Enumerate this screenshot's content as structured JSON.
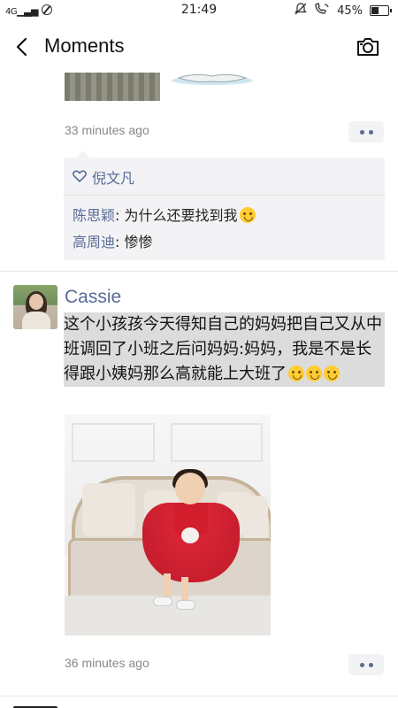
{
  "status_bar": {
    "network": "4G",
    "time": "21:49",
    "battery_percent": "45%"
  },
  "nav": {
    "title": "Moments"
  },
  "previous_post": {
    "timestamp": "33 minutes ago",
    "likes": {
      "names": "倪文凡"
    },
    "comments": [
      {
        "author": "陈思颖",
        "separator": ": ",
        "text": "为什么还要找到我"
      },
      {
        "author": "高周迪",
        "separator": ": ",
        "text": "惨惨"
      }
    ]
  },
  "post": {
    "author": "Cassie",
    "text": "这个小孩孩今天得知自己的妈妈把自己又从中班调回了小班之后问妈妈:妈妈，我是不是长得跟小姨妈那么高就能上大班了",
    "timestamp": "36 minutes ago"
  },
  "icons": {
    "back": "chevron-left-icon",
    "camera": "camera-icon",
    "like": "heart-outline-icon",
    "more": "more-dots-icon"
  },
  "colors": {
    "link_blue": "#576b95",
    "comment_bg": "#f3f3f5",
    "timestamp_gray": "#888888"
  }
}
